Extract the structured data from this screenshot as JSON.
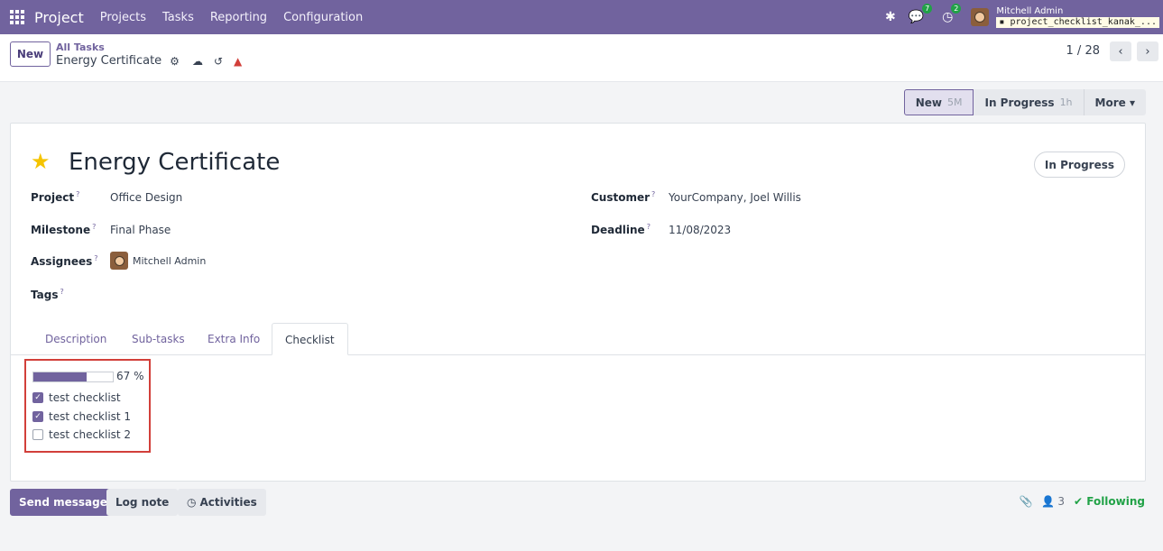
{
  "navbar": {
    "brand": "Project",
    "menu": [
      "Projects",
      "Tasks",
      "Reporting",
      "Configuration"
    ],
    "messages_count": "7",
    "activities_count": "2",
    "user_name": "Mitchell Admin",
    "db_name": "project_checklist_kanak_..."
  },
  "control": {
    "new_label": "New",
    "breadcrumb": "All Tasks",
    "record_name": "Energy Certificate",
    "pager": "1 / 28"
  },
  "statusbar": [
    {
      "label": "New",
      "duration": "5M",
      "active": true
    },
    {
      "label": "In Progress",
      "duration": "1h",
      "active": false
    },
    {
      "label": "More ▾",
      "duration": "",
      "active": false
    }
  ],
  "form": {
    "title": "Energy Certificate",
    "state": "In Progress",
    "fields": {
      "project_label": "Project",
      "project_value": "Office Design",
      "milestone_label": "Milestone",
      "milestone_value": "Final Phase",
      "assignees_label": "Assignees",
      "assignees_value": "Mitchell Admin",
      "tags_label": "Tags",
      "customer_label": "Customer",
      "customer_value": "YourCompany, Joel Willis",
      "deadline_label": "Deadline",
      "deadline_value": "11/08/2023",
      "help_mark": "?"
    },
    "tabs": [
      "Description",
      "Sub-tasks",
      "Extra Info",
      "Checklist"
    ],
    "active_tab": "Checklist",
    "checklist": {
      "progress_percent": 67,
      "progress_text": "67 %",
      "items": [
        {
          "label": "test checklist",
          "checked": true
        },
        {
          "label": "test checklist 1",
          "checked": true
        },
        {
          "label": "test checklist 2",
          "checked": false
        }
      ]
    }
  },
  "chatter": {
    "send_message": "Send message",
    "log_note": "Log note",
    "activities": "Activities",
    "followers_count": "3",
    "following": "Following"
  },
  "colors": {
    "brand": "#71639e",
    "highlight_box": "#d23f3a",
    "following": "#21a247",
    "star": "#f5c400"
  }
}
